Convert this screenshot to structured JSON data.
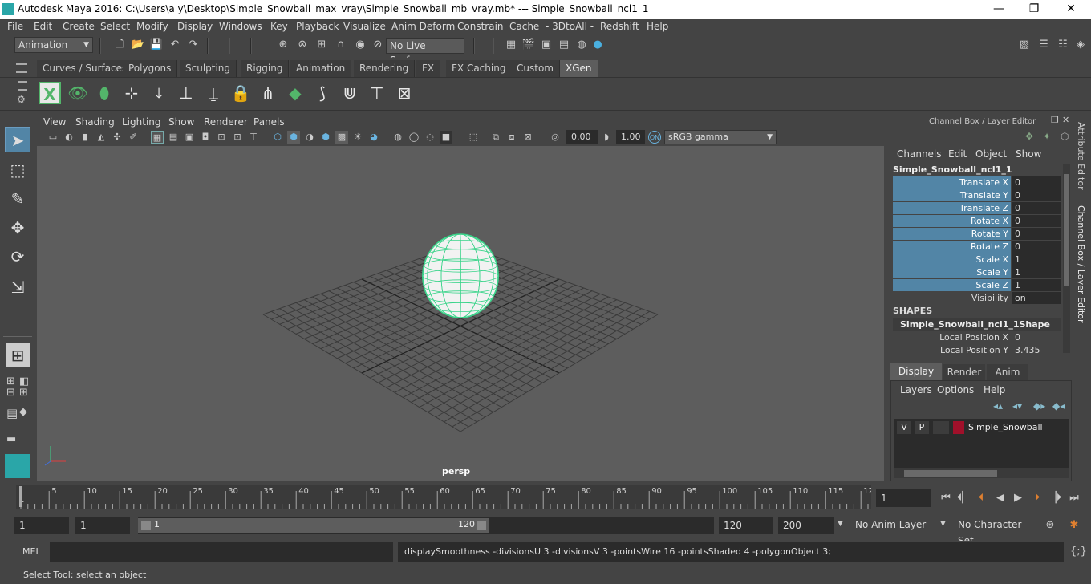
{
  "title": "Autodesk Maya 2016: C:\\Users\\a y\\Desktop\\Simple_Snowball_max_vray\\Simple_Snowball_mb_vray.mb*  ---  Simple_Snowball_ncl1_1",
  "window_buttons": {
    "minimize": "—",
    "maximize": "❐",
    "close": "✕"
  },
  "menu": [
    "File",
    "Edit",
    "Create",
    "Select",
    "Modify",
    "Display",
    "Windows",
    "Key",
    "Playback",
    "Visualize",
    "Anim Deform",
    "Constrain",
    "Cache",
    "- 3DtoAll -",
    "Redshift",
    "Help"
  ],
  "status": {
    "mode": "Animation",
    "live_surface": "No Live Surface"
  },
  "shelf_tabs": [
    "Curves / Surfaces",
    "Polygons",
    "Sculpting",
    "Rigging",
    "Animation",
    "Rendering",
    "FX",
    "FX Caching",
    "Custom",
    "XGen"
  ],
  "active_shelf": "XGen",
  "viewport": {
    "menu": [
      "View",
      "Shading",
      "Lighting",
      "Show",
      "Renderer",
      "Panels"
    ],
    "value1": "0.00",
    "value2": "1.00",
    "color_space": "sRGB gamma",
    "camera": "persp"
  },
  "channel_box": {
    "header": "Channel Box / Layer Editor",
    "menu": [
      "Channels",
      "Edit",
      "Object",
      "Show"
    ],
    "object": "Simple_Snowball_ncl1_1",
    "channels": [
      {
        "name": "Translate X",
        "value": "0"
      },
      {
        "name": "Translate Y",
        "value": "0"
      },
      {
        "name": "Translate Z",
        "value": "0"
      },
      {
        "name": "Rotate X",
        "value": "0"
      },
      {
        "name": "Rotate Y",
        "value": "0"
      },
      {
        "name": "Rotate Z",
        "value": "0"
      },
      {
        "name": "Scale X",
        "value": "1"
      },
      {
        "name": "Scale Y",
        "value": "1"
      },
      {
        "name": "Scale Z",
        "value": "1"
      },
      {
        "name": "Visibility",
        "value": "on"
      }
    ],
    "shapes_label": "SHAPES",
    "shape_name": "Simple_Snowball_ncl1_1Shape",
    "shape_channels": [
      {
        "name": "Local Position X",
        "value": "0"
      },
      {
        "name": "Local Position Y",
        "value": "3.435"
      }
    ],
    "side_tabs": [
      "Attribute Editor",
      "Channel Box / Layer Editor"
    ]
  },
  "layer_editor": {
    "tabs": [
      "Display",
      "Render",
      "Anim"
    ],
    "menu": [
      "Layers",
      "Options",
      "Help"
    ],
    "layer": {
      "v": "V",
      "p": "P",
      "name": "Simple_Snowball",
      "color": "#a0102a"
    }
  },
  "timeline": {
    "ticks": [
      "5",
      "10",
      "15",
      "20",
      "25",
      "30",
      "35",
      "40",
      "45",
      "50",
      "55",
      "60",
      "65",
      "70",
      "75",
      "80",
      "85",
      "90",
      "95",
      "100",
      "105",
      "110",
      "115",
      "12"
    ],
    "start_marker": "1",
    "current_frame": "1"
  },
  "range": {
    "start": "1",
    "anim_start": "1",
    "slider_start": "1",
    "slider_end": "120",
    "end": "120",
    "anim_end": "200",
    "anim_layer": "No Anim Layer",
    "char_set": "No Character Set"
  },
  "command": {
    "label": "MEL",
    "result": "displaySmoothness -divisionsU 3 -divisionsV 3 -pointsWire 16 -pointsShaded 4 -polygonObject 3;"
  },
  "help_line": "Select Tool: select an object",
  "colors": {
    "accent": "#5285a6",
    "wire": "#3ad48a",
    "xgen_green": "#53b56a"
  }
}
